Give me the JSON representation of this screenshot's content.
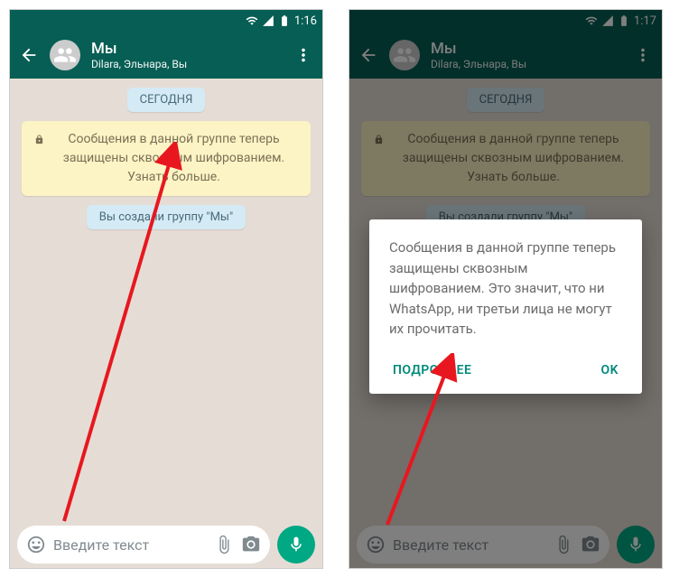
{
  "left": {
    "status_time": "1:16",
    "header": {
      "title": "Мы",
      "subtitle": "Dilara, Эльнара, Вы"
    },
    "date_pill": "СЕГОДНЯ",
    "encryption_notice": "Сообщения в данной группе теперь защищены сквозным шифрованием. Узнать больше.",
    "system_msg": "Вы создали группу \"Мы\"",
    "input_placeholder": "Введите текст"
  },
  "right": {
    "status_time": "1:17",
    "header": {
      "title": "Мы",
      "subtitle": "Dilara, Эльнара, Вы"
    },
    "date_pill": "СЕГОДНЯ",
    "encryption_notice": "Сообщения в данной группе теперь защищены сквозным шифрованием. Узнать больше.",
    "system_msg": "Вы создали группу \"Мы\"",
    "input_placeholder": "Введите текст",
    "dialog": {
      "text": "Сообщения в данной группе теперь защищены сквозным шифрованием. Это значит, что ни WhatsApp, ни третьи лица не могут их прочитать.",
      "more": "ПОДРОБНЕЕ",
      "ok": "OK"
    }
  }
}
